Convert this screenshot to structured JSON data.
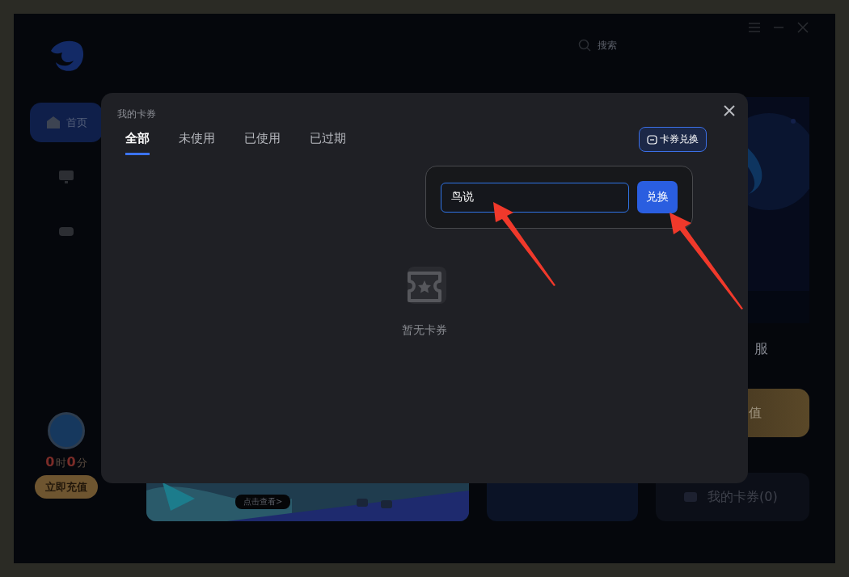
{
  "sidebar": {
    "items": [
      {
        "kind": "home",
        "label": "首页",
        "selected": true
      },
      {
        "kind": "monitor",
        "selected": false
      },
      {
        "kind": "gamepad",
        "selected": false
      }
    ],
    "timer": {
      "hours": "0",
      "hours_unit": "时",
      "minutes": "0",
      "minutes_unit": "分"
    },
    "recharge_button": "立即充值"
  },
  "search": {
    "placeholder": "搜索"
  },
  "content": {
    "region_label": "服",
    "recharge_label": "值",
    "banner_button": "点击查看>",
    "coupons_card": "我的卡券(0)"
  },
  "dialog": {
    "title": "我的卡券",
    "tabs": [
      {
        "label": "全部",
        "selected": true
      },
      {
        "label": "未使用",
        "selected": false
      },
      {
        "label": "已使用",
        "selected": false
      },
      {
        "label": "已过期",
        "selected": false
      }
    ],
    "exchange_button": "卡券兑换",
    "redeem": {
      "value": "鸟说",
      "button": "兑换"
    },
    "empty_text": "暂无卡券"
  }
}
